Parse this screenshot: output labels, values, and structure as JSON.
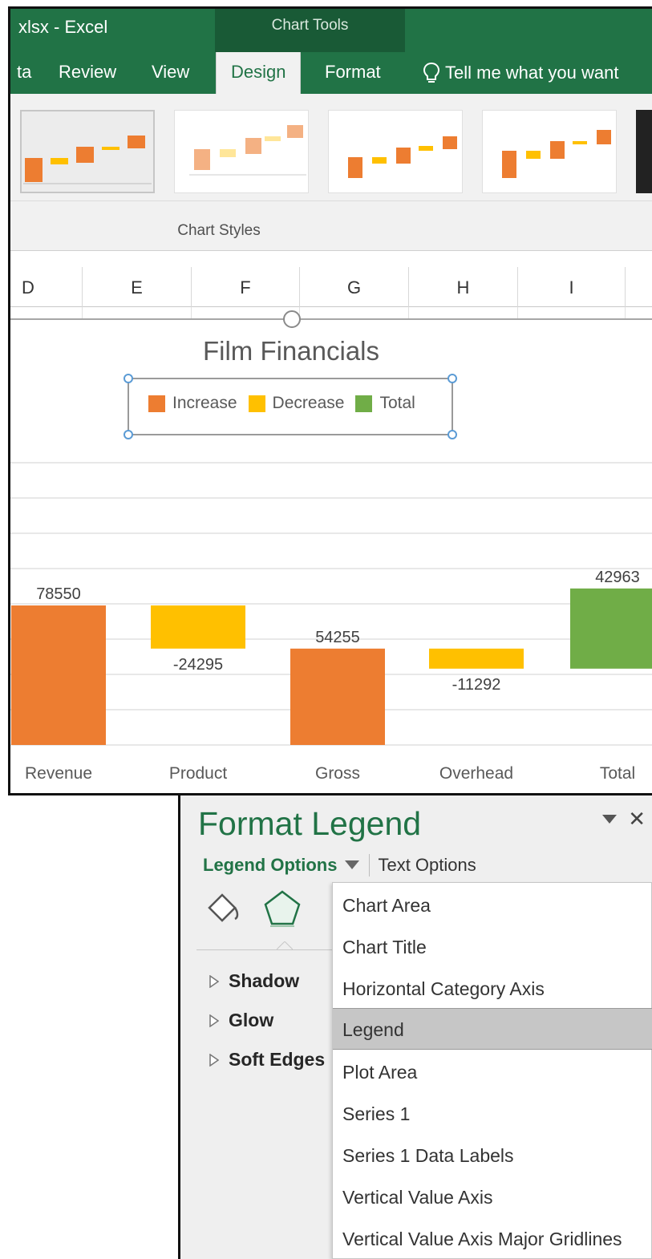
{
  "window": {
    "title": "xlsx - Excel",
    "context_tab_group": "Chart Tools"
  },
  "ribbon": {
    "tabs": [
      {
        "label": "ta"
      },
      {
        "label": "Review"
      },
      {
        "label": "View"
      },
      {
        "label": "Design",
        "active": true
      },
      {
        "label": "Format"
      }
    ],
    "tell_me": "Tell me what you want",
    "group_label": "Chart Styles"
  },
  "sheet": {
    "columns": [
      "D",
      "E",
      "F",
      "G",
      "H",
      "I"
    ]
  },
  "colors": {
    "increase": "#ED7D31",
    "decrease": "#FFC000",
    "total": "#70AD47",
    "excel_green": "#217346"
  },
  "chart_data": {
    "type": "bar",
    "title": "Film Financials",
    "legend": [
      "Increase",
      "Decrease",
      "Total"
    ],
    "legend_placement": "top",
    "categories": [
      "Revenue",
      "Product",
      "Gross",
      "Overhead",
      "Total"
    ],
    "values": [
      78550,
      -24295,
      54255,
      -11292,
      42963
    ],
    "data_labels": [
      "78550",
      "-24295",
      "54255",
      "-11292",
      "42963"
    ],
    "bars": [
      {
        "category": "Revenue",
        "start": 0,
        "end": 78550,
        "kind": "increase"
      },
      {
        "category": "Product",
        "start": 78550,
        "end": 54255,
        "kind": "decrease"
      },
      {
        "category": "Gross",
        "start": 0,
        "end": 54255,
        "kind": "increase"
      },
      {
        "category": "Overhead",
        "start": 54255,
        "end": 42963,
        "kind": "decrease"
      },
      {
        "category": "Total",
        "start": 42963,
        "end": 42963,
        "kind": "total"
      }
    ],
    "grid": true
  },
  "pane": {
    "title": "Format Legend",
    "tab_legend_options": "Legend Options",
    "tab_text_options": "Text Options",
    "close_glyph": "✕",
    "sections": [
      "Shadow",
      "Glow",
      "Soft Edges"
    ],
    "icons": [
      "fill-line-icon",
      "effects-icon",
      "size-properties-icon"
    ]
  },
  "dropdown": {
    "items": [
      {
        "label": "Chart Area"
      },
      {
        "label": "Chart Title"
      },
      {
        "label": "Horizontal Category Axis"
      },
      {
        "label": "Legend",
        "selected": true
      },
      {
        "label": "Plot Area"
      },
      {
        "label": "Series 1"
      },
      {
        "label": "Series 1 Data Labels"
      },
      {
        "label": "Vertical Value Axis"
      },
      {
        "label": "Vertical Value Axis Major Gridlines"
      }
    ]
  }
}
